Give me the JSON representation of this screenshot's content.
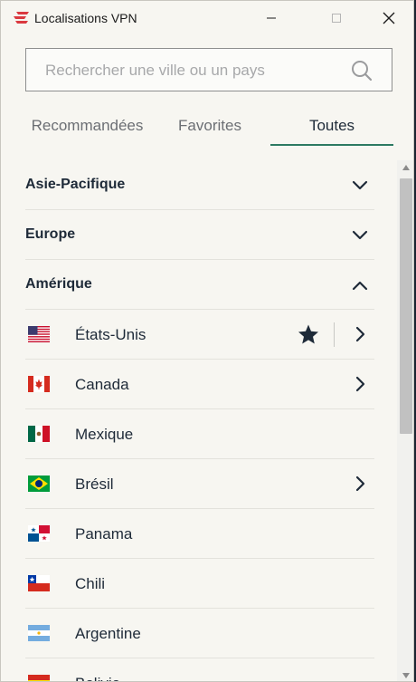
{
  "window": {
    "title": "Localisations VPN",
    "icon": "expressvpn-logo-icon",
    "controls": [
      "minimize-icon",
      "maximize-icon",
      "close-icon"
    ]
  },
  "search": {
    "placeholder": "Rechercher une ville ou un pays",
    "value": "",
    "icon": "search-icon"
  },
  "tabs": [
    {
      "label": "Recommandées",
      "active": false
    },
    {
      "label": "Favorites",
      "active": false
    },
    {
      "label": "Toutes",
      "active": true
    }
  ],
  "regions": [
    {
      "label": "Asie-Pacifique",
      "expanded": false
    },
    {
      "label": "Europe",
      "expanded": false
    },
    {
      "label": "Amérique",
      "expanded": true
    }
  ],
  "countries": [
    {
      "label": "États-Unis",
      "flag": "us-flag-icon",
      "favorite": true,
      "has_sublocations": true
    },
    {
      "label": "Canada",
      "flag": "canada-flag-icon",
      "favorite": false,
      "has_sublocations": true
    },
    {
      "label": "Mexique",
      "flag": "mexico-flag-icon",
      "favorite": false,
      "has_sublocations": false
    },
    {
      "label": "Brésil",
      "flag": "brazil-flag-icon",
      "favorite": false,
      "has_sublocations": true
    },
    {
      "label": "Panama",
      "flag": "panama-flag-icon",
      "favorite": false,
      "has_sublocations": false
    },
    {
      "label": "Chili",
      "flag": "chile-flag-icon",
      "favorite": false,
      "has_sublocations": false
    },
    {
      "label": "Argentine",
      "flag": "argentina-flag-icon",
      "favorite": false,
      "has_sublocations": false
    },
    {
      "label": "Bolivie",
      "flag": "bolivia-flag-icon",
      "favorite": false,
      "has_sublocations": false
    }
  ],
  "colors": {
    "background": "#f7f6f1",
    "text": "#1e2a38",
    "accent": "#2c7a62",
    "brand": "#da3940"
  },
  "scrollbar": {
    "position": 0.0,
    "visible_fraction": 0.53
  }
}
